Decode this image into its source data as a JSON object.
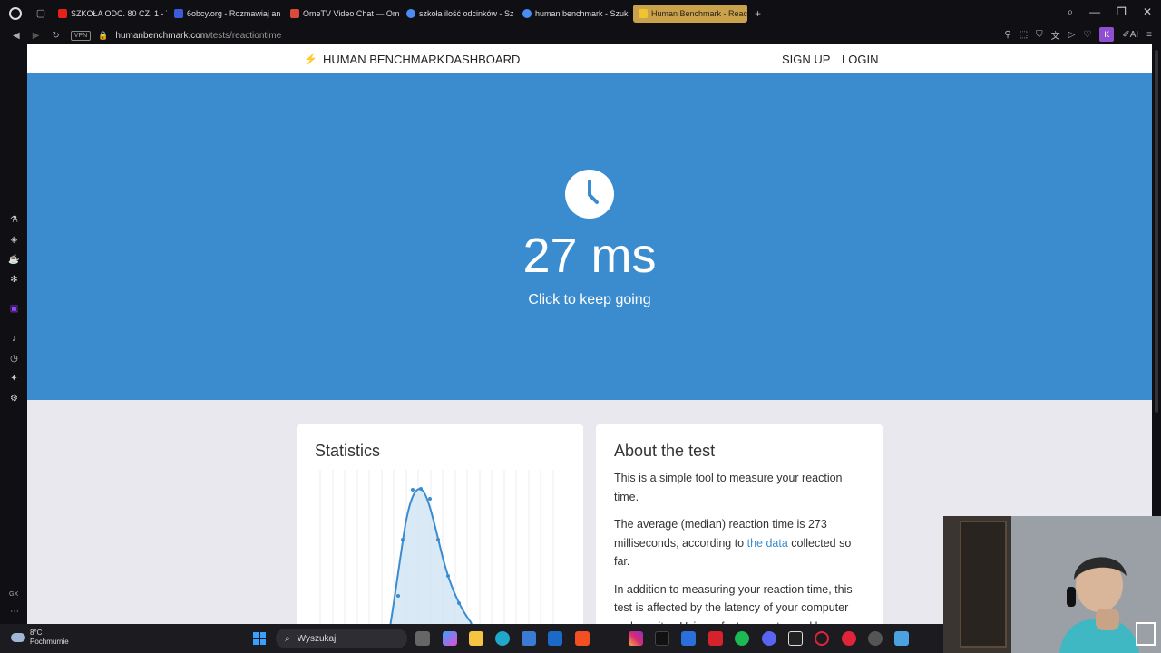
{
  "browser": {
    "tabs": [
      {
        "title": "SZKOŁA ODC. 80 CZ. 1 - Y",
        "color": "#e62117"
      },
      {
        "title": "6obcy.org - Rozmawiaj an",
        "color": "#3b5bdb"
      },
      {
        "title": "OmeTV Video Chat — Om",
        "color": "#d84a3a"
      },
      {
        "title": "szkoła ilość odcinków - Sz",
        "color": "#4a8ef5"
      },
      {
        "title": "human benchmark - Szuk",
        "color": "#4a8ef5"
      },
      {
        "title": "Human Benchmark - Reac",
        "color": "#f0c330"
      }
    ],
    "address": {
      "host": "humanbenchmark.com",
      "path": "/tests/reactiontime",
      "vpn_label": "VPN"
    },
    "profile_initial": "K",
    "ai_label": "AI",
    "sidebar_gx": "GX"
  },
  "site": {
    "brand": "HUMAN BENCHMARK",
    "nav_dashboard": "DASHBOARD",
    "nav_signup": "SIGN UP",
    "nav_login": "LOGIN"
  },
  "hero": {
    "result": "27 ms",
    "subtext": "Click to keep going",
    "bg_color": "#3a8ccf"
  },
  "stats": {
    "title": "Statistics"
  },
  "about": {
    "title": "About the test",
    "p1": "This is a simple tool to measure your reaction time.",
    "p2_before": "The average (median) reaction time is 273 milliseconds, according to ",
    "p2_link": "the data",
    "p2_after": " collected so far.",
    "p3": "In addition to measuring your reaction time, this test is affected by the latency of your computer and monitor. Using a fast computer and low latency / high framerate monitor will improve your score."
  },
  "taskbar": {
    "temp": "8°C",
    "weather": "Pochmurnie",
    "search_placeholder": "Wyszukaj"
  }
}
